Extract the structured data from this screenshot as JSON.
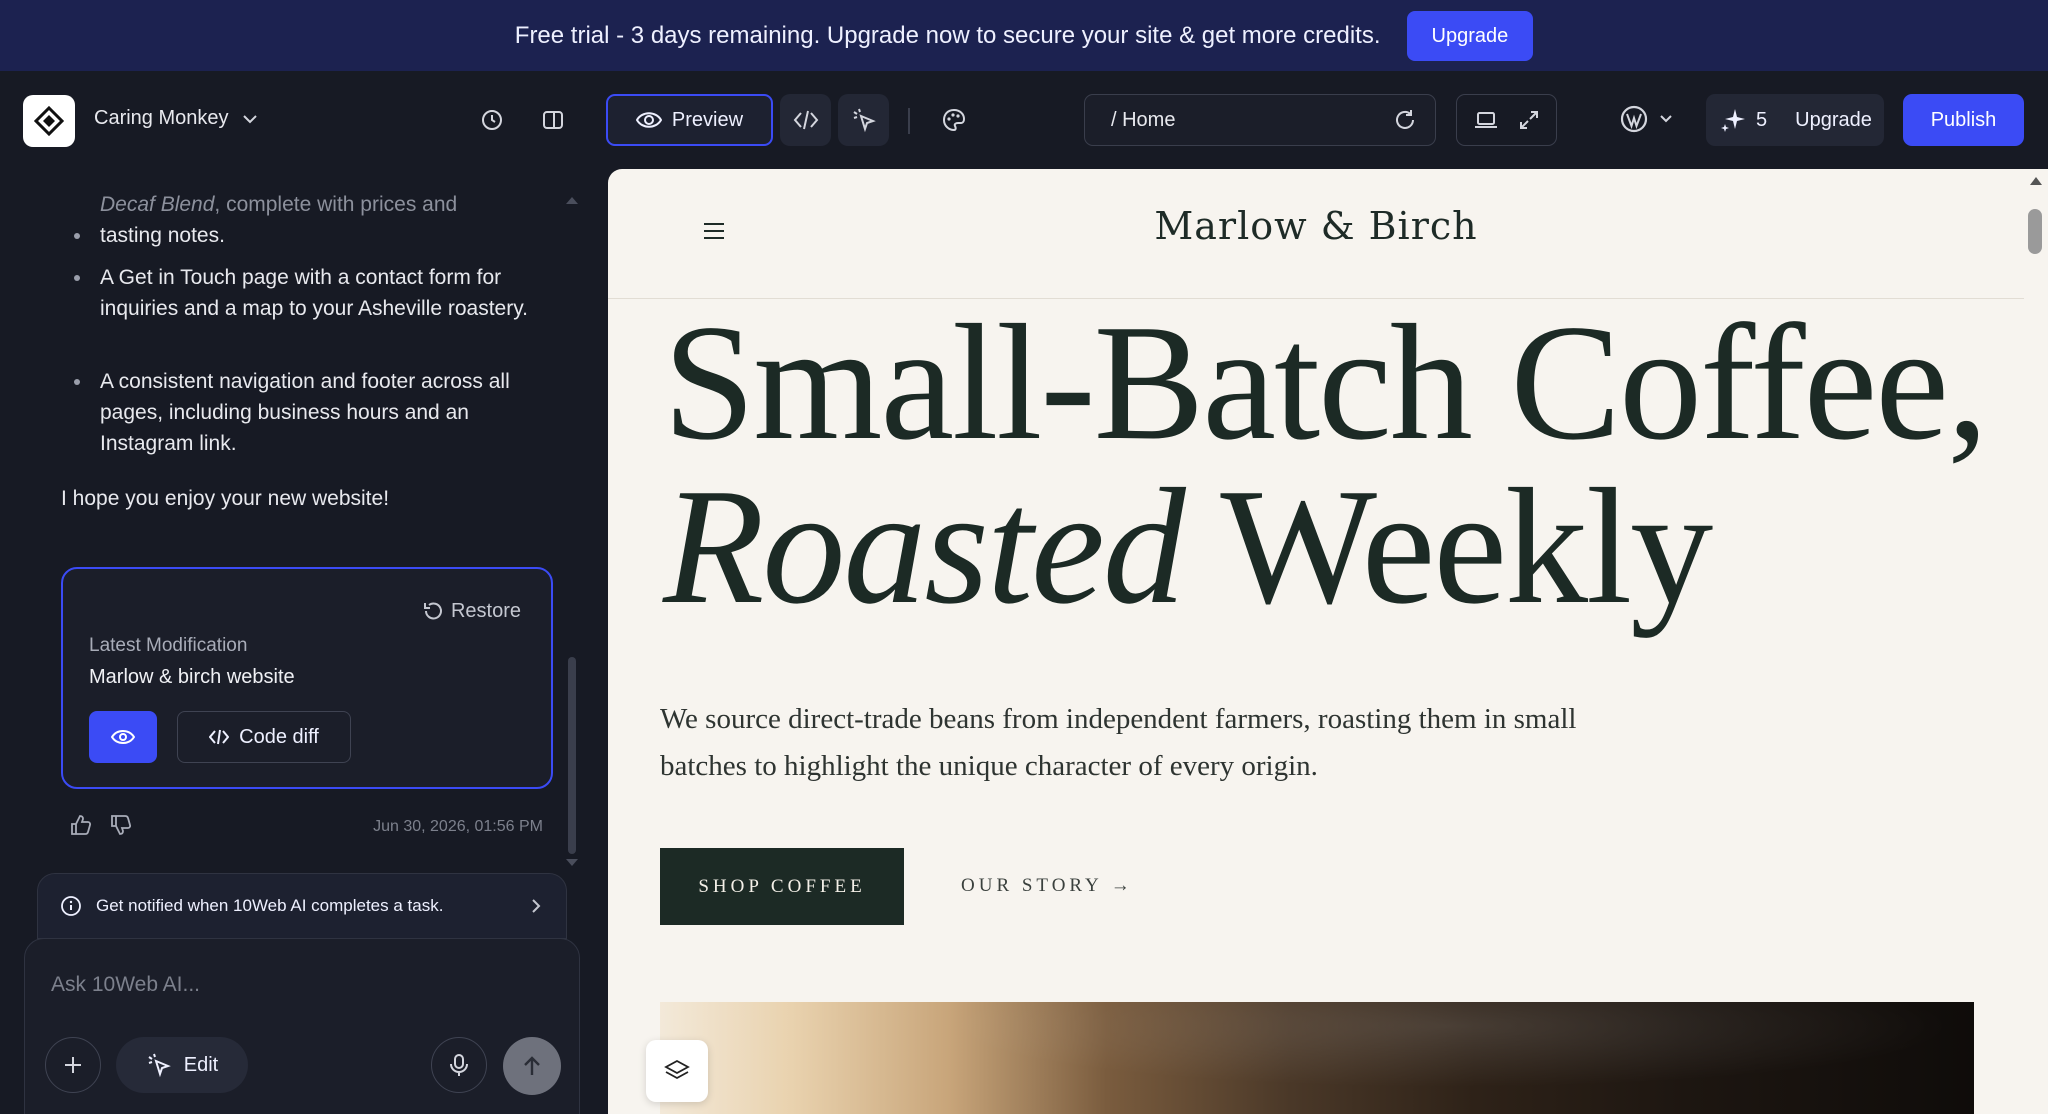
{
  "banner": {
    "message": "Free trial - 3 days remaining. Upgrade now to secure your site & get more credits.",
    "upgrade_label": "Upgrade"
  },
  "header": {
    "site_name": "Caring Monkey",
    "preview_label": "Preview",
    "url_path": "/ Home",
    "credits_count": "5",
    "upgrade_label": "Upgrade",
    "publish_label": "Publish"
  },
  "chat": {
    "bullets": [
      "Decaf Blend, complete with prices and tasting notes.",
      "A Get in Touch page with a contact form for inquiries and a map to your Asheville roastery.",
      "A consistent navigation and footer across all pages, including business hours and an Instagram link."
    ],
    "bullet0_italic": "Decaf Blend",
    "bullet0_rest": ", complete with prices and",
    "bullet0_line2": "tasting notes.",
    "closing": "I hope you enjoy your new website!",
    "modification": {
      "restore_label": "Restore",
      "label": "Latest Modification",
      "title": "Marlow & birch website",
      "code_diff_label": "Code diff"
    },
    "timestamp": "Jun 30, 2026, 01:56 PM",
    "notify_text": "Get notified when 10Web AI completes a task.",
    "composer_placeholder": "Ask 10Web AI...",
    "edit_label": "Edit"
  },
  "site": {
    "brand": "Marlow & Birch",
    "hero_line1": "Small-Batch Coffee,",
    "hero_line2_italic": "Roasted",
    "hero_line2_rest": " Weekly",
    "subtitle": "We source direct-trade beans from independent farmers, roasting them in small batches to highlight the unique character of every origin.",
    "shop_label": "SHOP COFFEE",
    "story_label": "OUR STORY →"
  },
  "colors": {
    "accent": "#3b4bf5",
    "banner_bg": "#1c2250",
    "app_bg": "#171a24",
    "site_bg": "#f7f4ef",
    "site_dark": "#1c2a25"
  },
  "icons": [
    "logo-icon",
    "chevron-down-icon",
    "history-icon",
    "sidebar-toggle-icon",
    "eye-icon",
    "code-icon",
    "pointer-select-icon",
    "palette-icon",
    "refresh-icon",
    "laptop-icon",
    "expand-icon",
    "wordpress-icon",
    "sparkle-icon",
    "restore-icon",
    "thumbs-up-icon",
    "thumbs-down-icon",
    "info-icon",
    "chevron-right-icon",
    "plus-icon",
    "microphone-icon",
    "arrow-up-icon",
    "hamburger-icon",
    "layers-icon"
  ]
}
